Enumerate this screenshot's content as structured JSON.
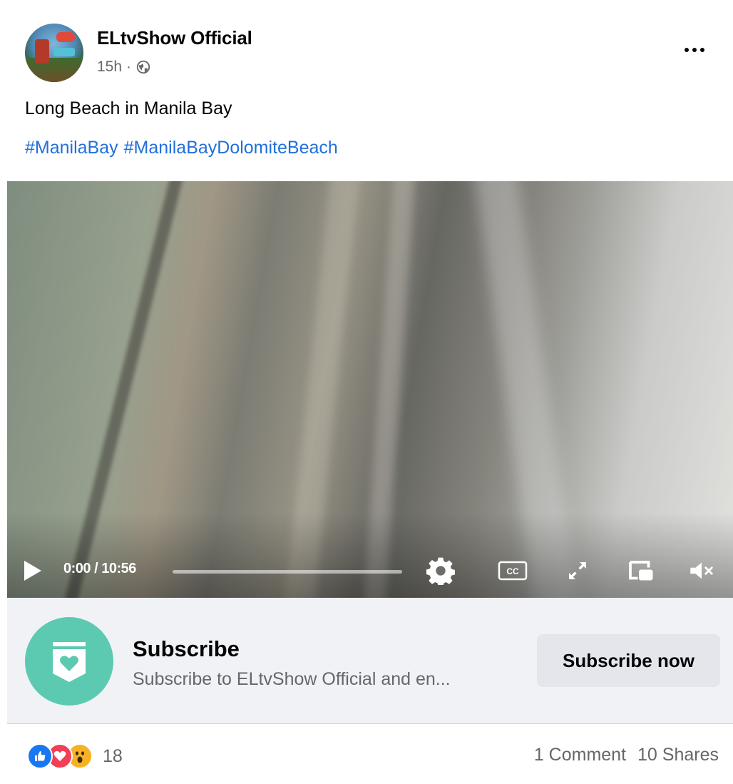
{
  "post": {
    "author": "ELtvShow Official",
    "timestamp": "15h",
    "separator": "·",
    "privacy_icon": "globe-icon",
    "more_icon": "more-options-icon",
    "caption": "Long Beach in Manila Bay",
    "hashtags": [
      "#ManilaBay",
      "#ManilaBayDolomiteBeach"
    ]
  },
  "video": {
    "time_display": "0:00 / 10:56",
    "progress": 0,
    "icons": [
      "play-icon",
      "settings-gear-icon",
      "closed-captions-icon",
      "fullscreen-icon",
      "picture-in-picture-icon",
      "mute-icon"
    ],
    "cc_label": "CC"
  },
  "subscribe": {
    "title": "Subscribe",
    "description": "Subscribe to ELtvShow Official and en...",
    "button_label": "Subscribe now",
    "accent_color": "#5cc9b1"
  },
  "footer": {
    "reaction_icons": [
      "like-reaction-icon",
      "love-reaction-icon",
      "wow-reaction-icon"
    ],
    "reaction_count": "18",
    "comments": "1 Comment",
    "shares": "10 Shares"
  },
  "colors": {
    "link": "#216fdb",
    "secondary_text": "#65676b",
    "panel_bg": "#f0f2f5",
    "button_bg": "#e4e6eb"
  }
}
